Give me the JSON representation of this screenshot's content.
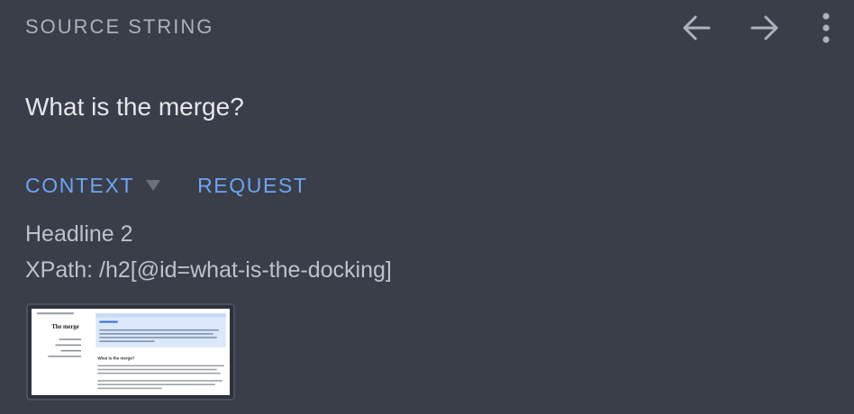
{
  "header": {
    "label": "SOURCE STRING",
    "actions": [
      "arrow-left-icon",
      "arrow-right-icon",
      "more-vert-icon"
    ]
  },
  "source": {
    "text": "What is the merge?"
  },
  "tabs": {
    "context_label": "CONTEXT",
    "request_label": "REQUEST"
  },
  "context": {
    "title": "Headline 2",
    "xpath": "XPath: /h2[@id=what-is-the-docking]"
  },
  "screenshot": {
    "heading": "The merge",
    "section_heading": "What is the merge?"
  },
  "colors": {
    "background": "#393e48",
    "muted_text": "#aeb2b8",
    "primary_text": "#e6e7e9",
    "accent": "#6ea4f6"
  }
}
